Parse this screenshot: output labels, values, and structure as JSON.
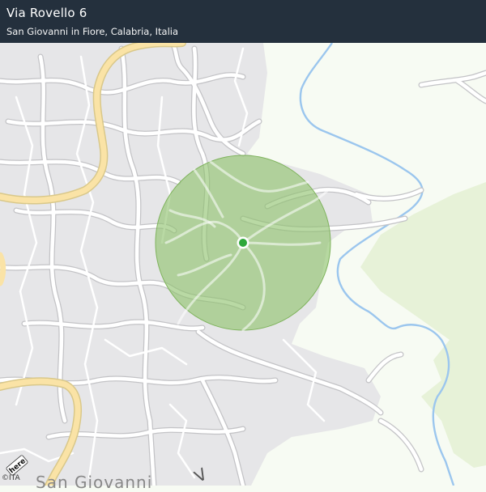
{
  "header": {
    "title": "Via Rovello 6",
    "subtitle": "San Giovanni in Fiore, Calabria, Italia"
  },
  "map": {
    "provider_logo": "here",
    "copyright": "©ITA",
    "place_label": "San Giovanni",
    "road_label": "V",
    "colors": {
      "land": "#f7fbf3",
      "urban": "#e6e6e8",
      "street": "#ffffff",
      "street_casing": "#c3c3c6",
      "main_road": "#fae3a6",
      "river": "#9bc6ee",
      "forest": "#e7f2d8",
      "accuracy_circle": "#8ec26c",
      "location_dot": "#2ea83a"
    }
  }
}
